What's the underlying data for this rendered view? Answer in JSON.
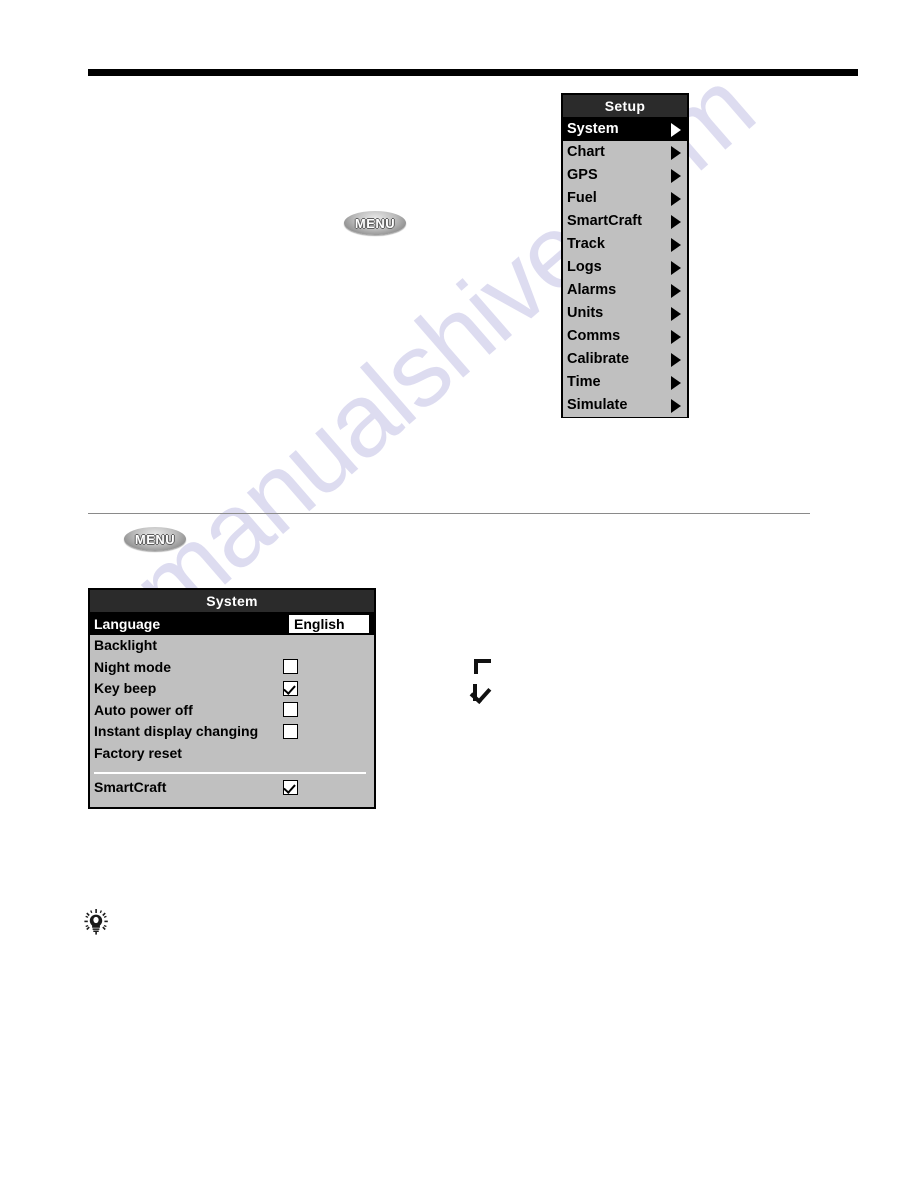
{
  "page": {
    "background_color": "#ffffff",
    "watermark_text": "manualshive.com",
    "watermark_color": "#c9c7e8"
  },
  "rules": {
    "top_rule_color": "#000000",
    "mid_rule_color": "#8a8a8a"
  },
  "keys": {
    "menu_label": "MENU",
    "menu_label_2": "MENU"
  },
  "setup_menu": {
    "title": "Setup",
    "selected_index": 0,
    "items": [
      {
        "label": "System",
        "arrow": "chevron-right-icon"
      },
      {
        "label": "Chart",
        "arrow": "chevron-right-icon"
      },
      {
        "label": "GPS",
        "arrow": "chevron-right-icon"
      },
      {
        "label": "Fuel",
        "arrow": "chevron-right-icon"
      },
      {
        "label": "SmartCraft",
        "arrow": "chevron-right-icon"
      },
      {
        "label": "Track",
        "arrow": "chevron-right-icon"
      },
      {
        "label": "Logs",
        "arrow": "chevron-right-icon"
      },
      {
        "label": "Alarms",
        "arrow": "chevron-right-icon"
      },
      {
        "label": "Units",
        "arrow": "chevron-right-icon"
      },
      {
        "label": "Comms",
        "arrow": "chevron-right-icon"
      },
      {
        "label": "Calibrate",
        "arrow": "chevron-right-icon"
      },
      {
        "label": "Time",
        "arrow": "chevron-right-icon"
      },
      {
        "label": "Simulate",
        "arrow": "chevron-right-icon"
      }
    ]
  },
  "system_menu": {
    "title": "System",
    "rows": [
      {
        "label": "Language",
        "type": "value",
        "value": "English",
        "selected": true
      },
      {
        "label": "Backlight",
        "type": "plain"
      },
      {
        "label": "Night mode",
        "type": "checkbox",
        "checked": false
      },
      {
        "label": "Key beep",
        "type": "checkbox",
        "checked": true
      },
      {
        "label": "Auto power off",
        "type": "checkbox",
        "checked": false
      },
      {
        "label": "Instant display changing",
        "type": "checkbox",
        "checked": false
      },
      {
        "label": "Factory reset",
        "type": "plain"
      },
      {
        "label": "SmartCraft",
        "type": "checkbox",
        "checked": true
      }
    ]
  },
  "legend": {
    "unchecked_glyph": "checkbox-unchecked-icon",
    "checked_glyph": "checkbox-checked-icon"
  },
  "tip": {
    "icon": "lightbulb-icon"
  }
}
